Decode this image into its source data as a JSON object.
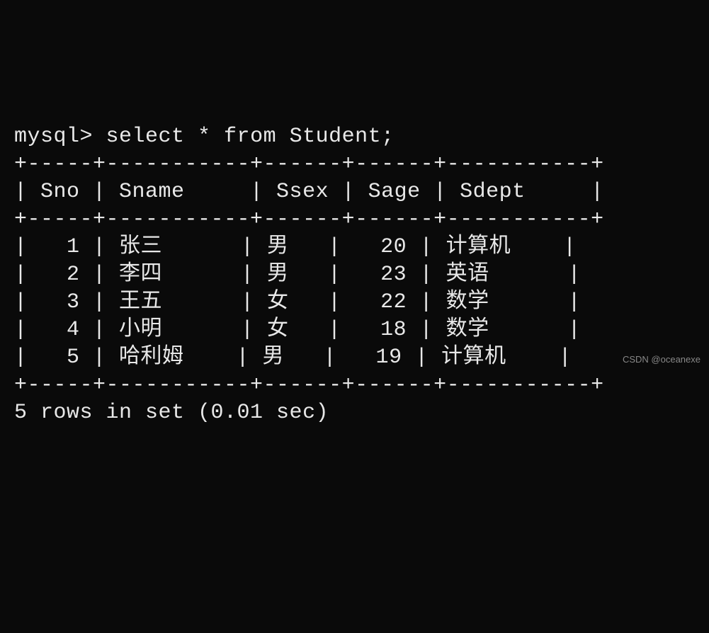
{
  "prompt": "mysql> ",
  "query": "select * from Student;",
  "border_top": "+-----+-----------+------+------+-----------+",
  "border_mid": "+-----+-----------+------+------+-----------+",
  "border_bottom": "+-----+-----------+------+------+-----------+",
  "header_row": "| Sno | Sname     | Ssex | Sage | Sdept     |",
  "rows": [
    "|   1 | 张三      | 男   |   20 | 计算机    |",
    "|   2 | 李四      | 男   |   23 | 英语      |",
    "|   3 | 王五      | 女   |   22 | 数学      |",
    "|   4 | 小明      | 女   |   18 | 数学      |",
    "|   5 | 哈利姆    | 男   |   19 | 计算机    |"
  ],
  "footer": "5 rows in set (0.01 sec)",
  "watermark": "CSDN @oceanexe",
  "chart_data": {
    "type": "table",
    "columns": [
      "Sno",
      "Sname",
      "Ssex",
      "Sage",
      "Sdept"
    ],
    "data": [
      {
        "Sno": 1,
        "Sname": "张三",
        "Ssex": "男",
        "Sage": 20,
        "Sdept": "计算机"
      },
      {
        "Sno": 2,
        "Sname": "李四",
        "Ssex": "男",
        "Sage": 23,
        "Sdept": "英语"
      },
      {
        "Sno": 3,
        "Sname": "王五",
        "Ssex": "女",
        "Sage": 22,
        "Sdept": "数学"
      },
      {
        "Sno": 4,
        "Sname": "小明",
        "Ssex": "女",
        "Sage": 18,
        "Sdept": "数学"
      },
      {
        "Sno": 5,
        "Sname": "哈利姆",
        "Ssex": "男",
        "Sage": 19,
        "Sdept": "计算机"
      }
    ]
  }
}
